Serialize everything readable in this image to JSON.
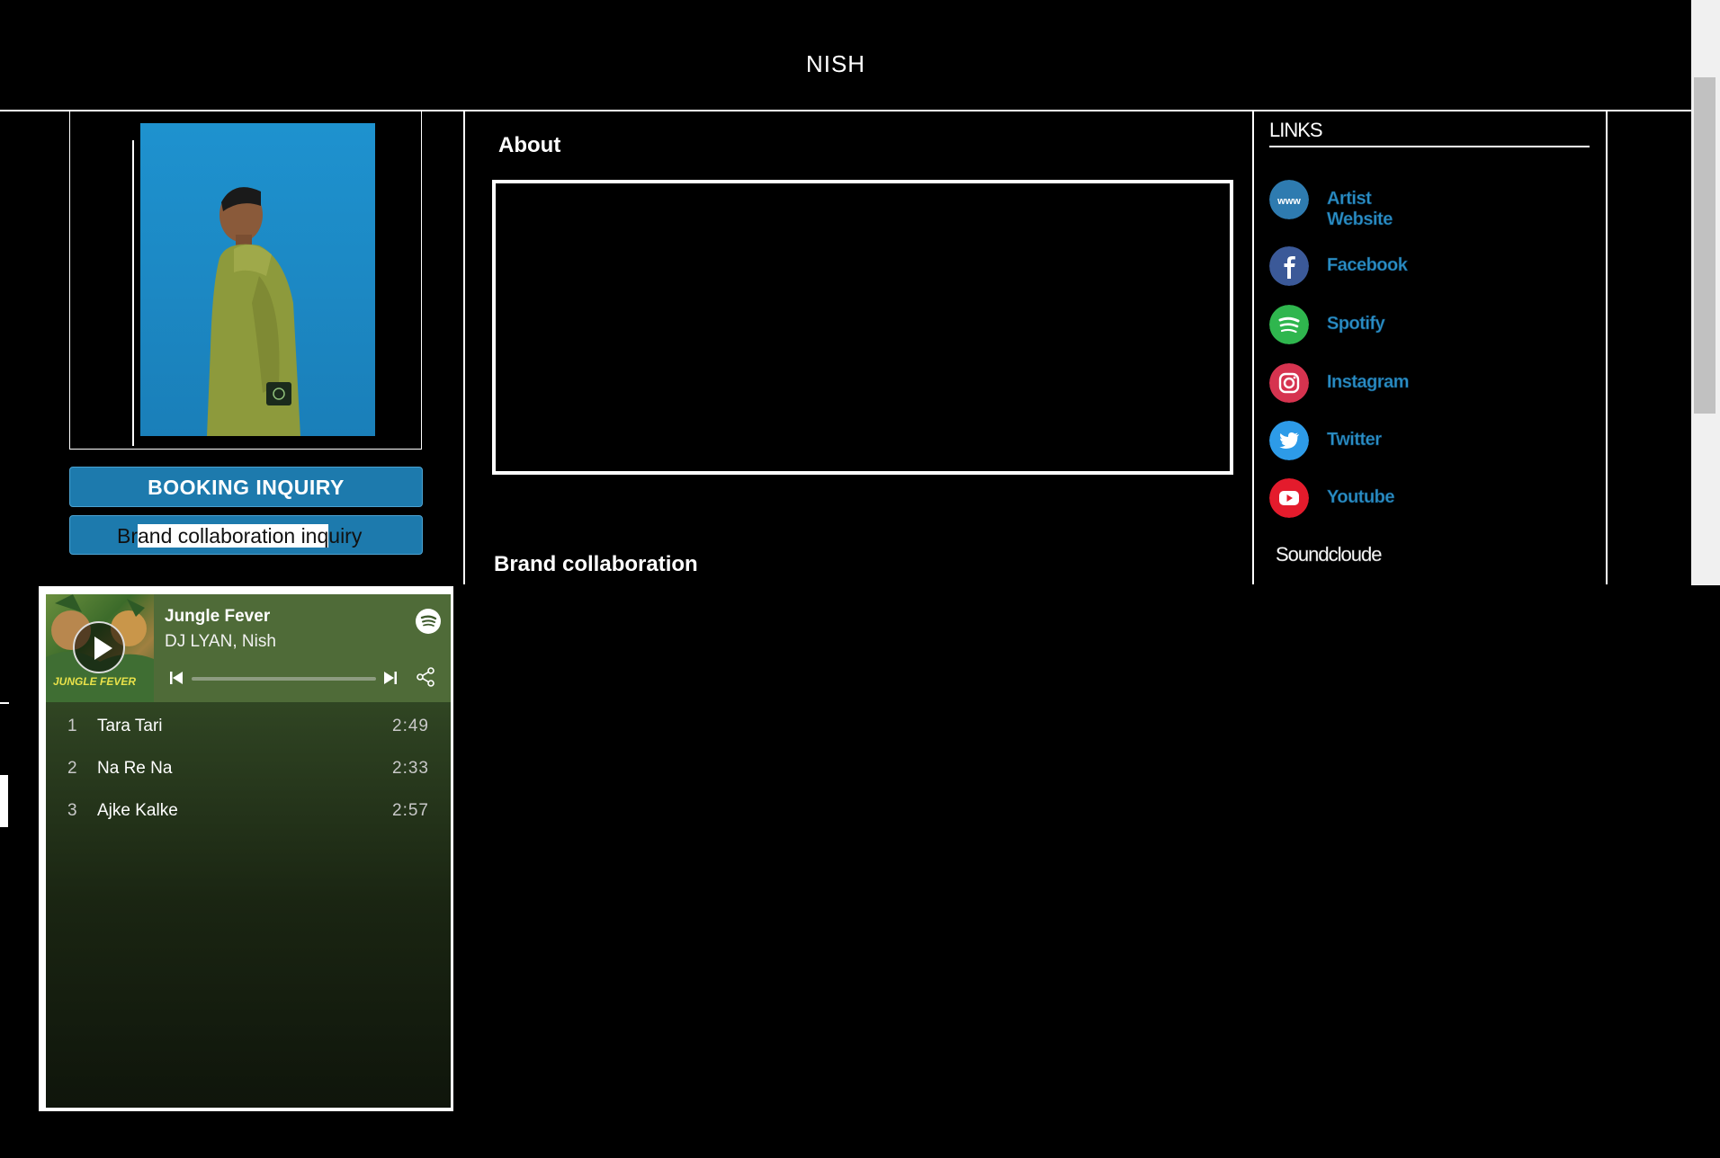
{
  "header": {
    "title": "NISH"
  },
  "buttons": {
    "booking_label": "BOOKING INQUIRY",
    "brand_label_pre": "Br",
    "brand_label_hl": "and collaboration inq",
    "brand_label_post": "uiry"
  },
  "player": {
    "title": "Jungle Fever",
    "artist": "DJ LYAN, Nish",
    "cover_text": "JUNGLE FEVER",
    "tracks": [
      {
        "num": "1",
        "name": "Tara Tari",
        "duration": "2:49"
      },
      {
        "num": "2",
        "name": "Na Re Na",
        "duration": "2:33"
      },
      {
        "num": "3",
        "name": "Ajke Kalke",
        "duration": "2:57"
      }
    ]
  },
  "main": {
    "about_heading": "About",
    "brand_heading": "Brand collaboration"
  },
  "links": {
    "heading": "LINKS",
    "items": [
      {
        "label": "Artist Website",
        "icon": "www-icon",
        "color": "#2e7bb0"
      },
      {
        "label": "Facebook",
        "icon": "facebook-icon",
        "color": "#3b5998"
      },
      {
        "label": "Spotify",
        "icon": "spotify-icon",
        "color": "#2fb64e"
      },
      {
        "label": "Instagram",
        "icon": "instagram-icon",
        "color": "#d6334f"
      },
      {
        "label": "Twitter",
        "icon": "twitter-icon",
        "color": "#2d9be8"
      },
      {
        "label": "Youtube",
        "icon": "youtube-icon",
        "color": "#e41b2c"
      }
    ],
    "soundcloud": "Soundcloude"
  }
}
